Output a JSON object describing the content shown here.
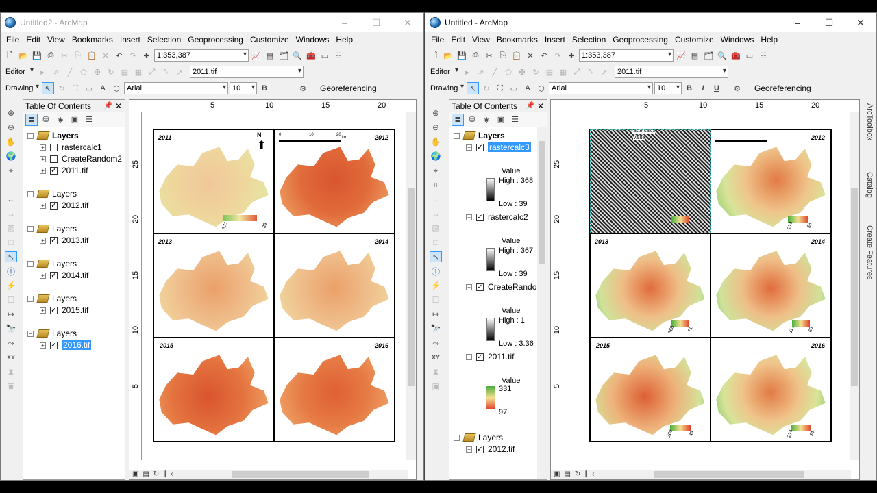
{
  "window1": {
    "title": "Untitled2 - ArcMap",
    "menus": [
      "File",
      "Edit",
      "View",
      "Bookmarks",
      "Insert",
      "Selection",
      "Geoprocessing",
      "Customize",
      "Windows",
      "Help"
    ],
    "scale": "1:353,387",
    "editor_label": "Editor",
    "layer_combo": "2011.tif",
    "drawing_label": "Drawing",
    "font": "Arial",
    "font_size": "10",
    "bold": "B",
    "georef_label": "Georeferencing",
    "toc_title": "Table Of Contents",
    "toc": [
      {
        "group": "Layers",
        "items": [
          {
            "name": "rastercalc1",
            "checked": false
          },
          {
            "name": "CreateRandom2",
            "checked": false
          },
          {
            "name": "2011.tif",
            "checked": true
          }
        ]
      },
      {
        "group": "Layers",
        "items": [
          {
            "name": "2012.tif",
            "checked": true
          }
        ]
      },
      {
        "group": "Layers",
        "items": [
          {
            "name": "2013.tif",
            "checked": true
          }
        ]
      },
      {
        "group": "Layers",
        "items": [
          {
            "name": "2014.tif",
            "checked": true
          }
        ]
      },
      {
        "group": "Layers",
        "items": [
          {
            "name": "2015.tif",
            "checked": true
          }
        ]
      },
      {
        "group": "Layers",
        "items": [
          {
            "name": "2016.tif",
            "checked": true,
            "selected": true
          }
        ]
      }
    ],
    "ruler_top": [
      "5",
      "10",
      "15",
      "20"
    ],
    "ruler_left": [
      "25",
      "20",
      "15",
      "10",
      "5"
    ],
    "panels": [
      "2011",
      "2012",
      "2013",
      "2014",
      "2015",
      "2016"
    ],
    "north": "N",
    "scalebar": [
      "0",
      "10",
      "20",
      "km"
    ],
    "legend_2011": [
      "371",
      "39"
    ]
  },
  "window2": {
    "title": "Untitled - ArcMap",
    "menus": [
      "File",
      "Edit",
      "View",
      "Bookmarks",
      "Insert",
      "Selection",
      "Geoprocessing",
      "Customize",
      "Windows",
      "Help"
    ],
    "scale": "1:353,387",
    "editor_label": "Editor",
    "layer_combo": "2011.tif",
    "drawing_label": "Drawing",
    "font": "Arial",
    "font_size": "10",
    "bold": "B",
    "italic": "I",
    "underline": "U",
    "georef_label": "Georeferencing",
    "toc_title": "Table Of Contents",
    "toc_root": "Layers",
    "layers": [
      {
        "name": "rastercalc3",
        "value_label": "Value",
        "high": "High : 368",
        "low": "Low : 39",
        "selected": true
      },
      {
        "name": "rastercalc2",
        "value_label": "Value",
        "high": "High : 367",
        "low": "Low : 39"
      },
      {
        "name": "CreateRando",
        "value_label": "Value",
        "high": "High : 1",
        "low": "Low : 3.36"
      },
      {
        "name": "2011.tif",
        "value_label": "Value",
        "high": "331",
        "low": "97"
      }
    ],
    "toc_group2": "Layers",
    "toc_group2_item": "2012.tif",
    "ruler_top": [
      "5",
      "10",
      "15",
      "20"
    ],
    "ruler_left": [
      "25",
      "20",
      "15",
      "10",
      "5"
    ],
    "panels": [
      "2011",
      "2012",
      "2013",
      "2014",
      "2015",
      "2016"
    ],
    "inset_title": "rastercalc3",
    "inset_value": "Value",
    "legends": {
      "2012": [
        "274",
        "53"
      ],
      "2013": [
        "368",
        "71"
      ],
      "2014": [
        "311",
        "60"
      ],
      "2015": [
        "260",
        "49"
      ],
      "2016": [
        "274",
        "54"
      ]
    },
    "side_tabs": [
      "ArcToolbox",
      "Catalog",
      "Create Features"
    ]
  },
  "colors": {
    "warm": "#e8844a",
    "cool": "#5aa83c",
    "mid": "#f2d98a",
    "selection": "#3399ff"
  }
}
